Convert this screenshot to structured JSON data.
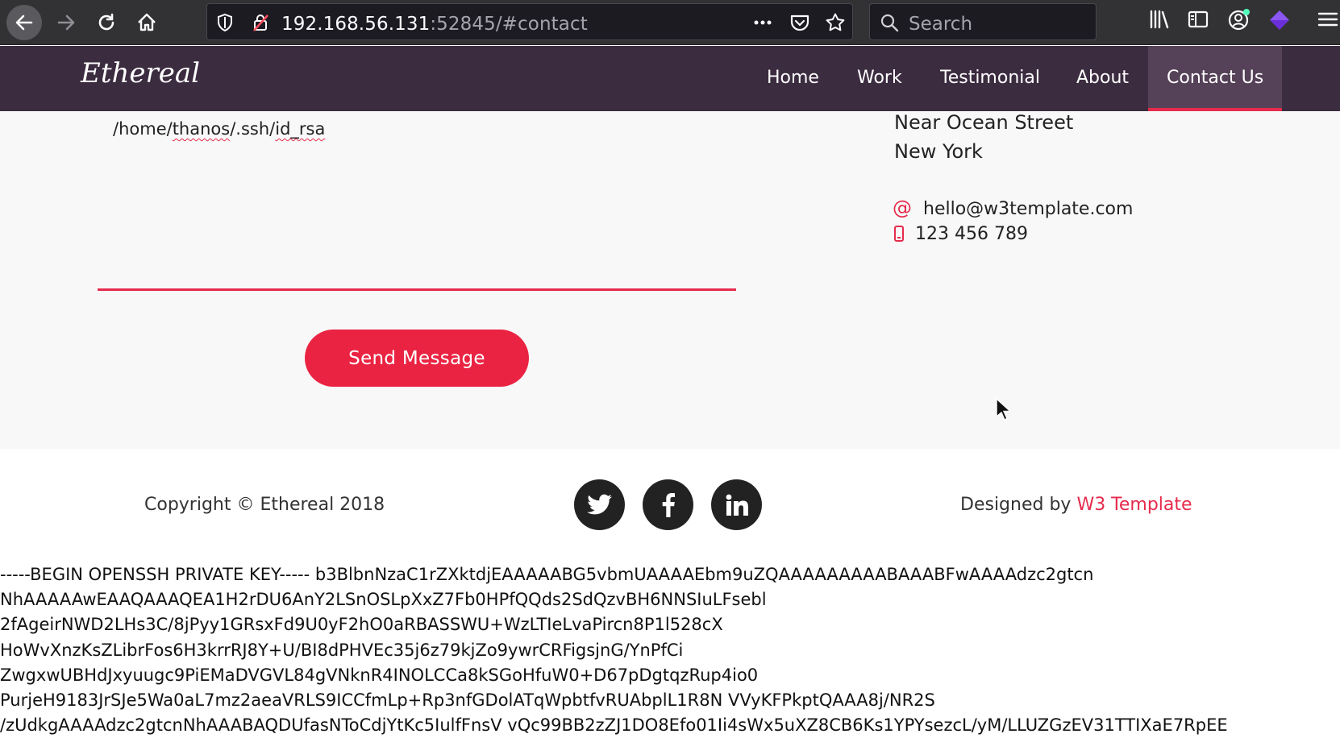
{
  "browser": {
    "url_host": "192.168.56.131",
    "url_rest": ":52845/#contact",
    "search_placeholder": "Search"
  },
  "site": {
    "logo": "Ethereal",
    "nav": [
      {
        "label": "Home"
      },
      {
        "label": "Work"
      },
      {
        "label": "Testimonial"
      },
      {
        "label": "About"
      },
      {
        "label": "Contact Us"
      }
    ]
  },
  "contact": {
    "message_prefix": "/home/",
    "message_user": "thanos",
    "message_mid": "/.ssh/",
    "message_file": "id_rsa",
    "send_label": "Send Message",
    "address_line1": "Near Ocean Street",
    "address_line2": "New York",
    "email_icon": "@",
    "email": "hello@w3template.com",
    "phone": "123 456 789"
  },
  "footer": {
    "copyright": "Copyright © Ethereal 2018",
    "designed_prefix": "Designed by ",
    "designed_brand": "W3 Template"
  },
  "key_lines": [
    "-----BEGIN OPENSSH PRIVATE KEY----- b3BlbnNzaC1rZXktdjEAAAAABG5vbmUAAAAEbm9uZQAAAAAAAAABAAABFwAAAAdzc2gtcn",
    "NhAAAAAwEAAQAAAQEA1H2rDU6AnY2LSnOSLpXxZ7Fb0HPfQQds2SdQzvBH6NNSIuLFsebl",
    "2fAgeirNWD2LHs3C/8jPyy1GRsxFd9U0yF2hO0aRBASSWU+WzLTIeLvaPircn8P1l528cX",
    "HoWvXnzKsZLibrFos6H3krrRJ8Y+U/BI8dPHVEc35j6z79kjZo9ywrCRFigsjnG/YnPfCi",
    "ZwgxwUBHdJxyuugc9PiEMaDVGVL84gVNknR4INOLCCa8kSGoHfuW0+D67pDgtqzRup4io0",
    "PurjeH9183JrSJe5Wa0aL7mz2aeaVRLS9ICCfmLp+Rp3nfGDolATqWpbtfvRUAbplL1R8N VVyKFPkptQAAA8j/NR2S",
    "/zUdkgAAAAdzc2gtcnNhAAABAQDUfasNToCdjYtKc5IulfFnsV vQc99BB2zZJ1DO8Efo01Ii4sWx5uXZ8CB6Ks1YPYsezcL/yM/LLUZGzEV31TTIXaE7RpEE"
  ]
}
